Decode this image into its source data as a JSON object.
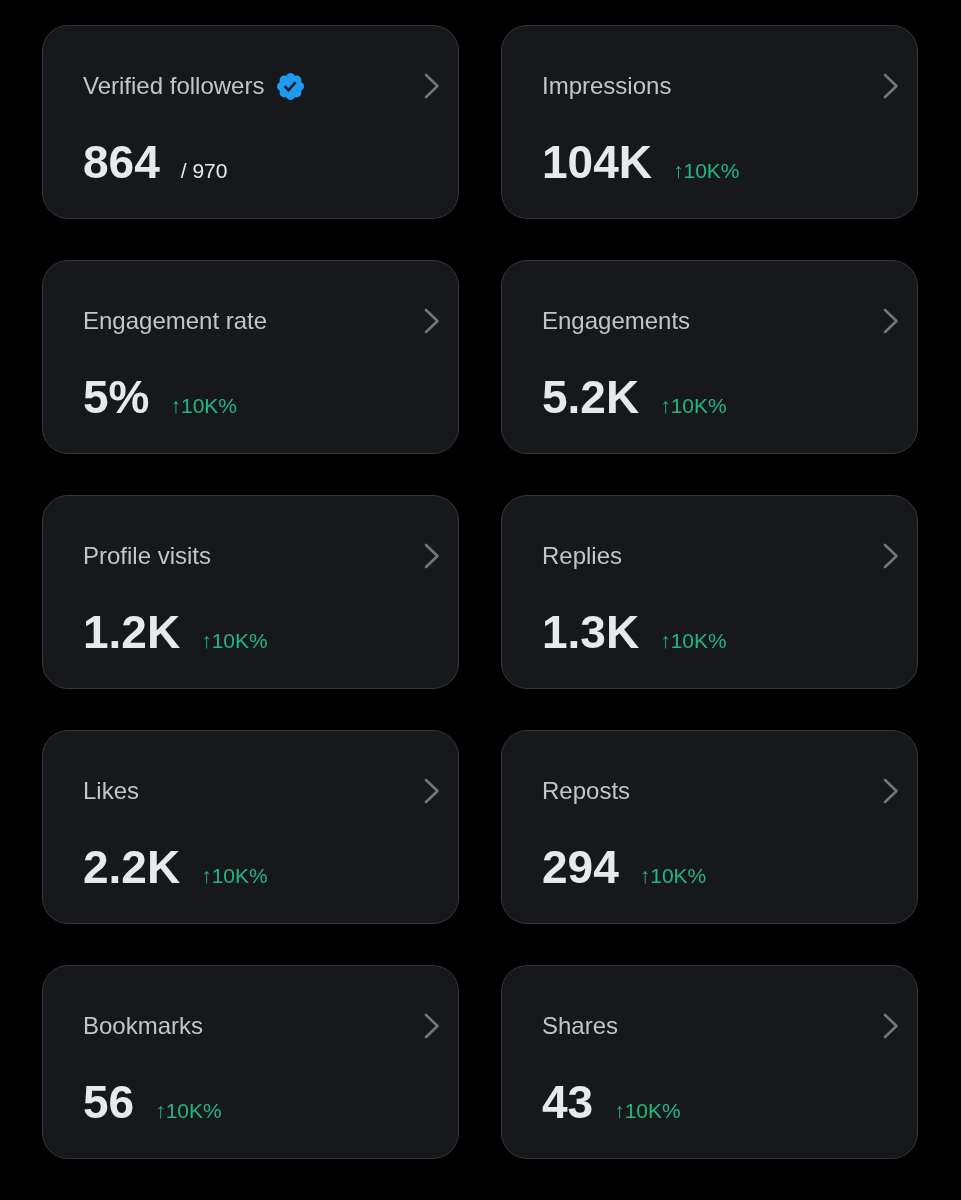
{
  "cards": [
    {
      "title": "Verified followers",
      "verified": true,
      "value": "864",
      "total": "/ 970"
    },
    {
      "title": "Impressions",
      "verified": false,
      "value": "104K",
      "change": "↑10K%"
    },
    {
      "title": "Engagement rate",
      "verified": false,
      "value": "5%",
      "change": "↑10K%"
    },
    {
      "title": "Engagements",
      "verified": false,
      "value": "5.2K",
      "change": "↑10K%"
    },
    {
      "title": "Profile visits",
      "verified": false,
      "value": "1.2K",
      "change": "↑10K%"
    },
    {
      "title": "Replies",
      "verified": false,
      "value": "1.3K",
      "change": "↑10K%"
    },
    {
      "title": "Likes",
      "verified": false,
      "value": "2.2K",
      "change": "↑10K%"
    },
    {
      "title": "Reposts",
      "verified": false,
      "value": "294",
      "change": "↑10K%"
    },
    {
      "title": "Bookmarks",
      "verified": false,
      "value": "56",
      "change": "↑10K%"
    },
    {
      "title": "Shares",
      "verified": false,
      "value": "43",
      "change": "↑10K%"
    }
  ]
}
